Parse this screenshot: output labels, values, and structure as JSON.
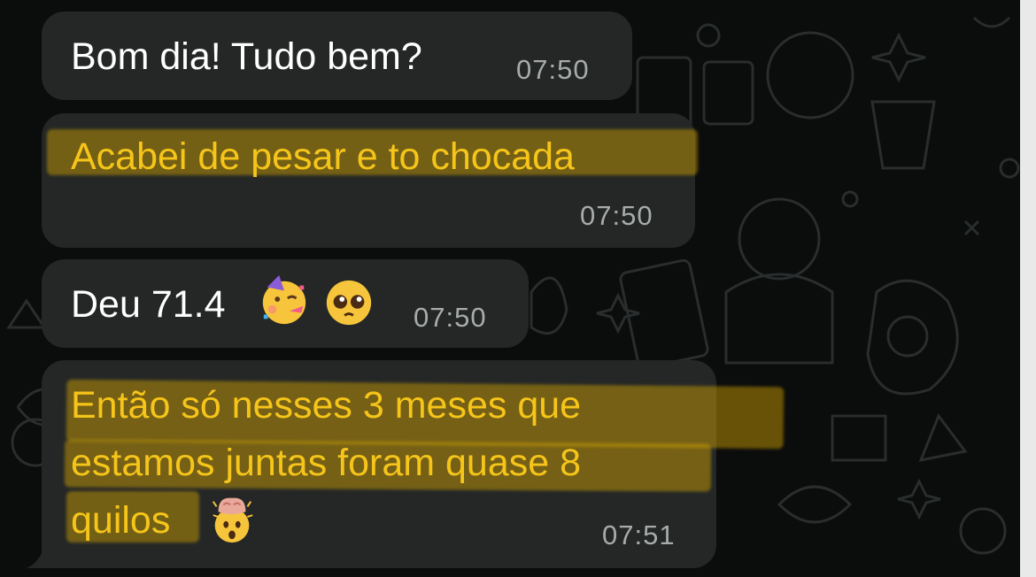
{
  "messages": [
    {
      "text": "Bom dia! Tudo bem?",
      "time": "07:50"
    },
    {
      "text": "Acabei de pesar e to chocada",
      "time": "07:50"
    },
    {
      "text": "Deu 71.4",
      "emojis": [
        "partying-face",
        "pleading-face"
      ],
      "time": "07:50"
    },
    {
      "lines": [
        "Então só nesses 3 meses que",
        "estamos juntas foram quase 8",
        "quilos"
      ],
      "emojis": [
        "exploding-head"
      ],
      "time": "07:51"
    }
  ],
  "colors": {
    "background": "#0b0c0c",
    "bubble": "#242726",
    "highlight_text": "#f6c51a",
    "timestamp": "#a7abab"
  }
}
